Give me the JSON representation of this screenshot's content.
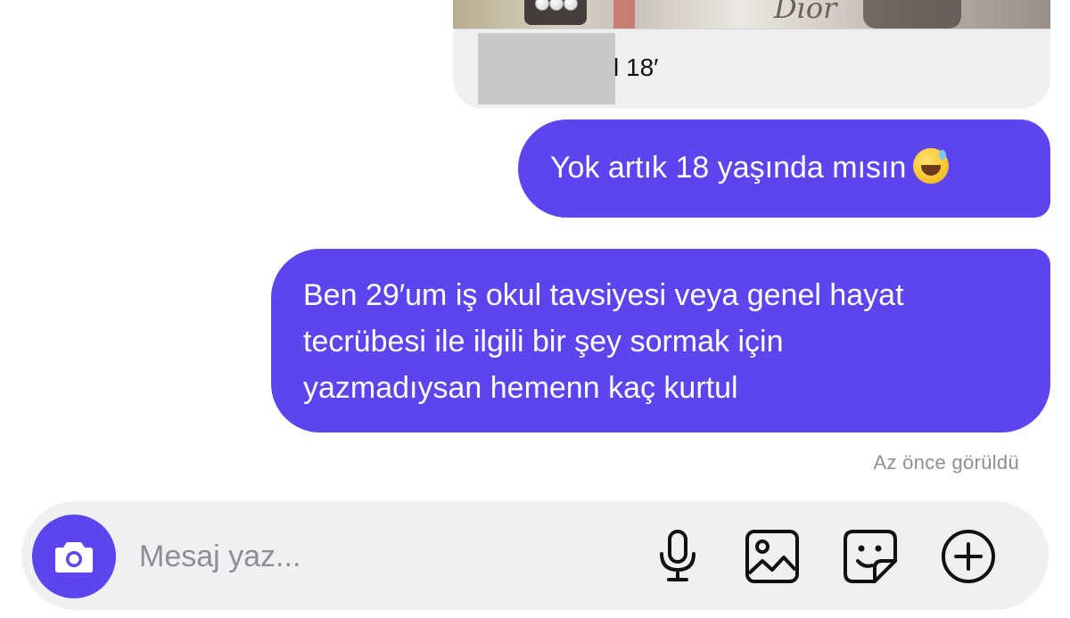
{
  "shared_post": {
    "caption": "l 18′",
    "image_logo_text": "Dior"
  },
  "messages": [
    {
      "id": "msg-1",
      "text": "Yok artık 18 yaşında mısın",
      "emoji": "grinning-face-with-sweat"
    },
    {
      "id": "msg-2",
      "lines": [
        "Ben 29′um iş okul tavsiyesi veya genel hayat",
        "tecrübesi ile ilgili bir şey sormak için",
        "yazmadıysan hemenn kaç kurtul"
      ]
    }
  ],
  "status": {
    "seen_text": "Az önce görüldü"
  },
  "composer": {
    "placeholder": "Mesaj yaz...",
    "value": "",
    "icons": [
      "camera-icon",
      "microphone-icon",
      "gallery-icon",
      "sticker-icon",
      "plus-circle-icon"
    ]
  },
  "colors": {
    "accent": "#5a45ef",
    "bubble_text": "#ffffff",
    "incoming_bg": "#efeff1",
    "composer_bg": "#f0f0f2",
    "muted_text": "#8e8e93",
    "icon_color": "#111111"
  }
}
